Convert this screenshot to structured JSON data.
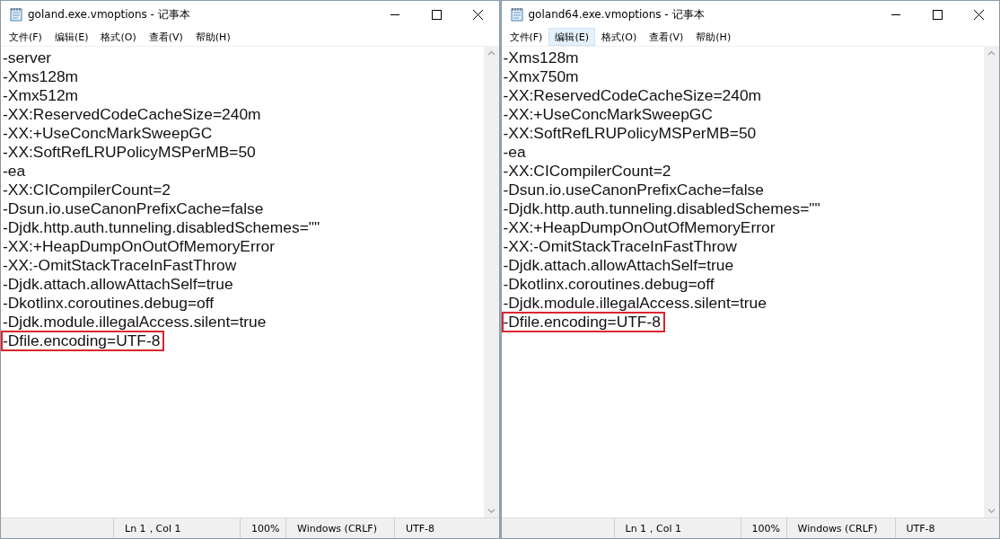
{
  "windows": [
    {
      "title": "goland.exe.vmoptions - 记事本",
      "menu": [
        {
          "label": "文件(F)",
          "selected": false
        },
        {
          "label": "编辑(E)",
          "selected": false
        },
        {
          "label": "格式(O)",
          "selected": false
        },
        {
          "label": "查看(V)",
          "selected": false
        },
        {
          "label": "帮助(H)",
          "selected": false
        }
      ],
      "lines": [
        {
          "text": "-server",
          "highlighted": false
        },
        {
          "text": "-Xms128m",
          "highlighted": false
        },
        {
          "text": "-Xmx512m",
          "highlighted": false
        },
        {
          "text": "-XX:ReservedCodeCacheSize=240m",
          "highlighted": false
        },
        {
          "text": "-XX:+UseConcMarkSweepGC",
          "highlighted": false
        },
        {
          "text": "-XX:SoftRefLRUPolicyMSPerMB=50",
          "highlighted": false
        },
        {
          "text": "-ea",
          "highlighted": false
        },
        {
          "text": "-XX:CICompilerCount=2",
          "highlighted": false
        },
        {
          "text": "-Dsun.io.useCanonPrefixCache=false",
          "highlighted": false
        },
        {
          "text": "-Djdk.http.auth.tunneling.disabledSchemes=\"\"",
          "highlighted": false
        },
        {
          "text": "-XX:+HeapDumpOnOutOfMemoryError",
          "highlighted": false
        },
        {
          "text": "-XX:-OmitStackTraceInFastThrow",
          "highlighted": false
        },
        {
          "text": "-Djdk.attach.allowAttachSelf=true",
          "highlighted": false
        },
        {
          "text": "-Dkotlinx.coroutines.debug=off",
          "highlighted": false
        },
        {
          "text": "-Djdk.module.illegalAccess.silent=true",
          "highlighted": false
        },
        {
          "text": "-Dfile.encoding=UTF-8",
          "highlighted": true
        }
      ],
      "status_bar": [
        "Ln 1，Col 1",
        "100%",
        "Windows (CRLF)",
        "UTF-8"
      ]
    },
    {
      "title": "goland64.exe.vmoptions - 记事本",
      "menu": [
        {
          "label": "文件(F)",
          "selected": false
        },
        {
          "label": "编辑(E)",
          "selected": true
        },
        {
          "label": "格式(O)",
          "selected": false
        },
        {
          "label": "查看(V)",
          "selected": false
        },
        {
          "label": "帮助(H)",
          "selected": false
        }
      ],
      "lines": [
        {
          "text": "-Xms128m",
          "highlighted": false
        },
        {
          "text": "-Xmx750m",
          "highlighted": false
        },
        {
          "text": "-XX:ReservedCodeCacheSize=240m",
          "highlighted": false
        },
        {
          "text": "-XX:+UseConcMarkSweepGC",
          "highlighted": false
        },
        {
          "text": "-XX:SoftRefLRUPolicyMSPerMB=50",
          "highlighted": false
        },
        {
          "text": "-ea",
          "highlighted": false
        },
        {
          "text": "-XX:CICompilerCount=2",
          "highlighted": false
        },
        {
          "text": "-Dsun.io.useCanonPrefixCache=false",
          "highlighted": false
        },
        {
          "text": "-Djdk.http.auth.tunneling.disabledSchemes=\"\"",
          "highlighted": false
        },
        {
          "text": "-XX:+HeapDumpOnOutOfMemoryError",
          "highlighted": false
        },
        {
          "text": "-XX:-OmitStackTraceInFastThrow",
          "highlighted": false
        },
        {
          "text": "-Djdk.attach.allowAttachSelf=true",
          "highlighted": false
        },
        {
          "text": "-Dkotlinx.coroutines.debug=off",
          "highlighted": false
        },
        {
          "text": "-Djdk.module.illegalAccess.silent=true",
          "highlighted": false
        },
        {
          "text": "-Dfile.encoding=UTF-8",
          "highlighted": true
        }
      ],
      "status_bar": [
        "Ln 1，Col 1",
        "100%",
        "Windows (CRLF)",
        "UTF-8"
      ]
    }
  ]
}
